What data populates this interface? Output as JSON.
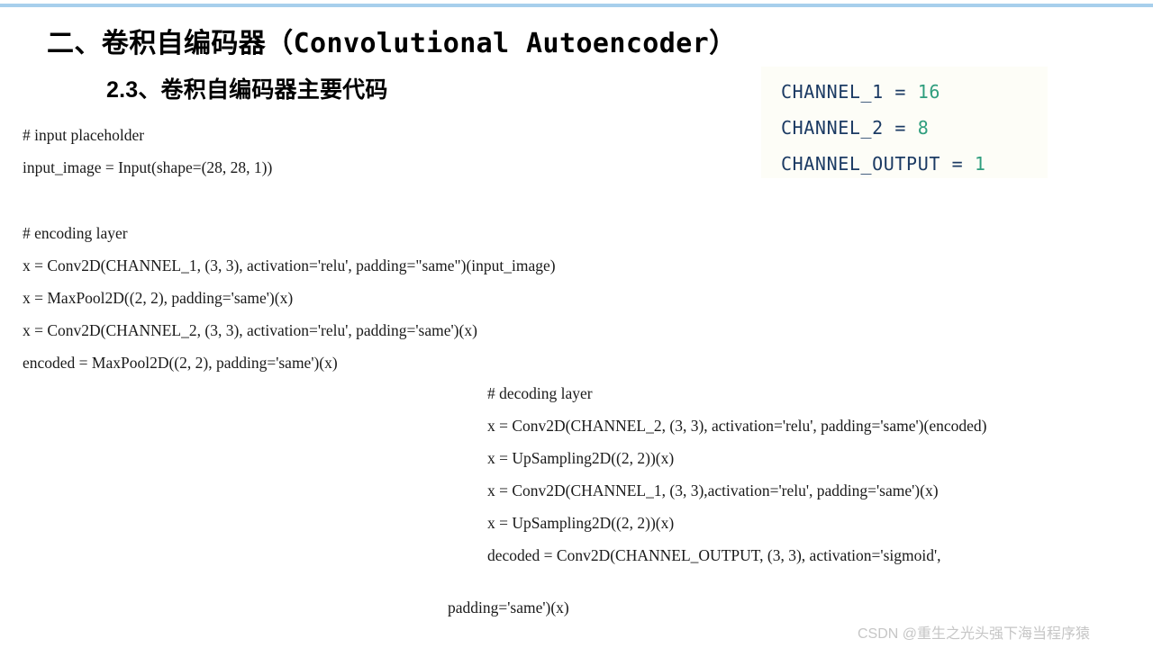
{
  "slide": {
    "title": "二、卷积自编码器（Convolutional Autoencoder）",
    "subtitle": "2.3、卷积自编码器主要代码",
    "top_rule_color": "#a7cfec",
    "background_color": "#ffffff"
  },
  "constants": {
    "background_color": "#fdfdf7",
    "name_color": "#1b3a63",
    "number_color": "#2f9e7e",
    "lines": [
      {
        "name": "CHANNEL_1",
        "op": " = ",
        "value": "16"
      },
      {
        "name": "CHANNEL_2",
        "op": " = ",
        "value": "8"
      },
      {
        "name": "CHANNEL_OUTPUT",
        "op": " = ",
        "value": "1"
      }
    ]
  },
  "input_block": {
    "lines": [
      "# input placeholder",
      "input_image = Input(shape=(28, 28, 1))"
    ]
  },
  "encoder_block": {
    "lines": [
      "# encoding layer",
      "x = Conv2D(CHANNEL_1, (3, 3), activation='relu', padding=\"same\")(input_image)",
      "x = MaxPool2D((2, 2), padding='same')(x)",
      "x = Conv2D(CHANNEL_2, (3, 3), activation='relu', padding='same')(x)",
      "encoded = MaxPool2D((2, 2), padding='same')(x)"
    ]
  },
  "decoder_block": {
    "lines": [
      "# decoding layer",
      "x = Conv2D(CHANNEL_2, (3, 3), activation='relu', padding='same')(encoded)",
      "x = UpSampling2D((2, 2))(x)",
      "x = Conv2D(CHANNEL_1, (3, 3),activation='relu', padding='same')(x)",
      "x = UpSampling2D((2, 2))(x)",
      "decoded = Conv2D(CHANNEL_OUTPUT, (3, 3), activation='sigmoid',"
    ],
    "wrapped_line": "padding='same')(x)"
  },
  "watermark": {
    "text": "CSDN @重生之光头强下海当程序猿",
    "color": "#c6c6c6"
  }
}
